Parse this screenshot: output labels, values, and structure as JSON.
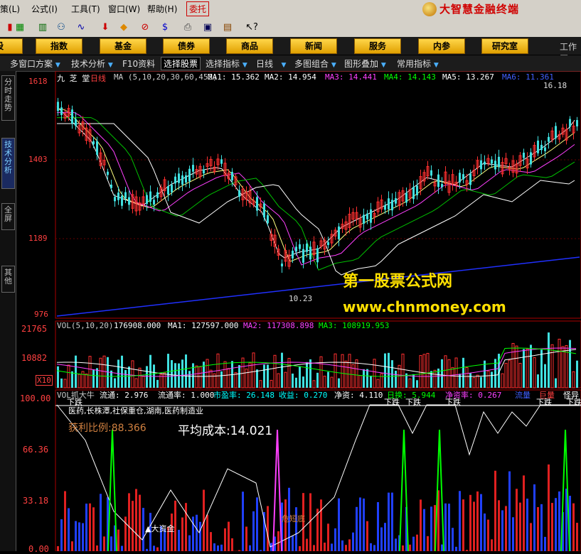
{
  "menu": {
    "items": [
      "策(L)",
      "公式(I)",
      "工具(T)",
      "窗口(W)",
      "帮助(H)"
    ],
    "entrust": "委托",
    "brand": "大智慧金融终端"
  },
  "toolbar": {
    "icons": [
      "stock-tick-icon",
      "chart-bars-icon",
      "binoculars-icon",
      "wave-icon",
      "arrow-down-icon",
      "diamond-icon",
      "ban-icon",
      "dollar-icon",
      "printer-icon",
      "window-icon",
      "books-icon",
      "help-cursor-icon"
    ]
  },
  "nav": {
    "buttons": [
      "股",
      "指数",
      "基金",
      "债券",
      "商品",
      "新闻",
      "服务",
      "内参",
      "研究室"
    ],
    "workspace": "工作区"
  },
  "tabs": {
    "multi": "多窗口方案",
    "tech": "技术分析",
    "f10": "F10资料",
    "select_stock": "选择股票",
    "select_indicator": "选择指标",
    "daily": "日线",
    "overlay": "多图组合",
    "graph": "图形叠加",
    "common": "常用指标"
  },
  "sidebar": {
    "tabs": [
      "分时走势",
      "技术分析",
      "全屏",
      "其他"
    ]
  },
  "main": {
    "stock": "九 芝 堂",
    "period": "日线",
    "ma_label": "MA (5,10,20,30,60,452)",
    "ma": [
      {
        "name": "MA1:",
        "value": "15.362",
        "color": "#ffffff"
      },
      {
        "name": "MA2:",
        "value": "14.954",
        "color": "#ffffff"
      },
      {
        "name": "MA3:",
        "value": "14.441",
        "color": "#ff40ff"
      },
      {
        "name": "MA4:",
        "value": "14.143",
        "color": "#00ff00"
      },
      {
        "name": "MA5:",
        "value": "13.267",
        "color": "#ffffff"
      },
      {
        "name": "MA6:",
        "value": "11.361",
        "color": "#4060ff"
      }
    ],
    "y_ticks": [
      "1618",
      "1403",
      "1189",
      "976"
    ],
    "high_label": "16.18",
    "low_label": "10.23"
  },
  "watermark": {
    "title": "第一股票公式网",
    "url": "www.chnmoney.com"
  },
  "vol": {
    "label": "VOL(5,10,20)",
    "value": "176908.000",
    "ma": [
      {
        "name": "MA1:",
        "value": "127597.000",
        "color": "#ffffff"
      },
      {
        "name": "MA2:",
        "value": "117308.898",
        "color": "#ff40ff"
      },
      {
        "name": "MA3:",
        "value": "108919.953",
        "color": "#00ff00"
      }
    ],
    "y_ticks": [
      "21765",
      "10882"
    ],
    "scale": "X10"
  },
  "indicator": {
    "name": "VOL抓大牛",
    "stats": [
      {
        "name": "流通:",
        "value": "2.976"
      },
      {
        "name": "流通率:",
        "value": "1.000"
      },
      {
        "name": "市盈率:",
        "value": "26.148"
      },
      {
        "name": "收益:",
        "value": "0.270"
      },
      {
        "name": "净资:",
        "value": "4.110"
      },
      {
        "name": "日换:",
        "value": "5.944"
      },
      {
        "name": "净资率:",
        "value": "0.267"
      }
    ],
    "flags": [
      "流量",
      "巨量",
      "怪异"
    ],
    "sector": "医药,长株潭,社保重仓,湖南,医药制造业",
    "profit_label": "获利比例:",
    "profit": "88.366",
    "cost_label": "平均成本:",
    "cost": "14.021",
    "y_ticks": [
      "100.00",
      "66.36",
      "33.18",
      "0.00"
    ],
    "fall_label": "下跌",
    "big_money": "大资金",
    "danger": "危短底"
  }
}
